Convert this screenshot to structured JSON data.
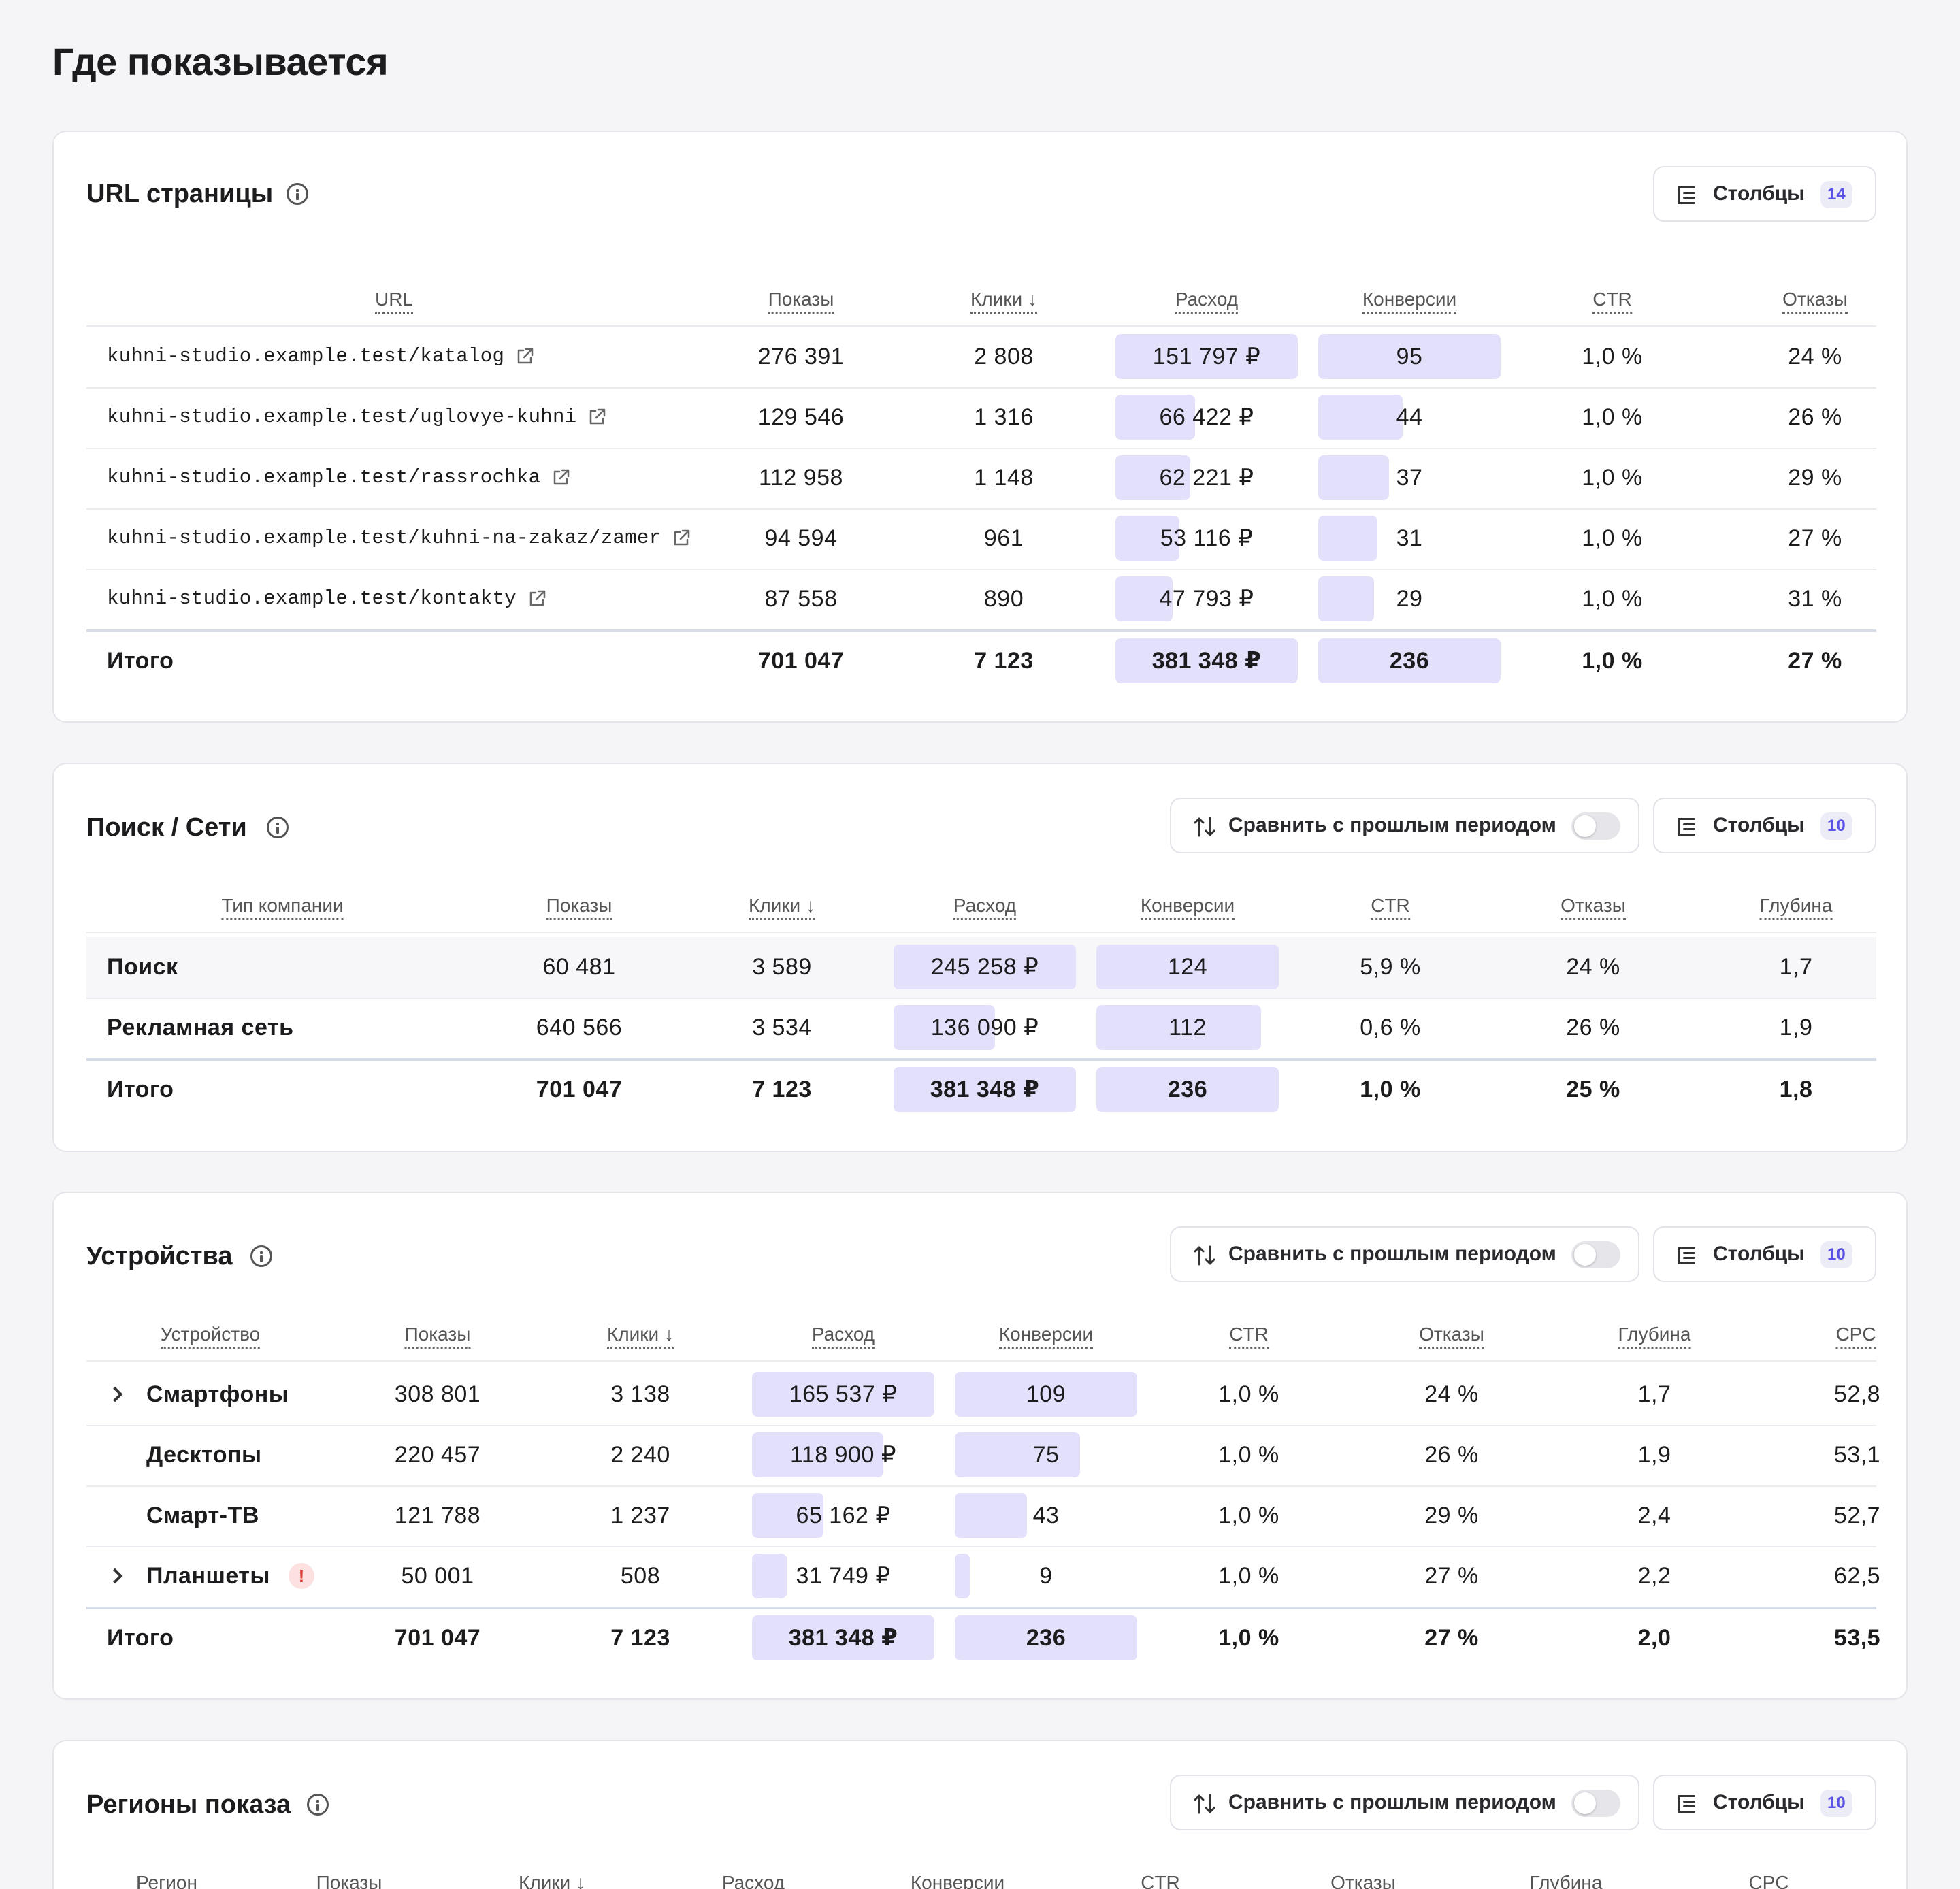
{
  "page_title": "Где показывается",
  "compare_label": "Сравнить с прошлым периодом",
  "columns_label": "Столбцы",
  "total_label": "Итого",
  "colors": {
    "bar": "#e3e0fb",
    "badge_text": "#5b52e6",
    "warn": "#e0403a"
  },
  "url_section": {
    "title": "URL страницы",
    "columns_count": "14",
    "headers": [
      "URL",
      "Показы",
      "Клики ↓",
      "Расход",
      "Конверсии",
      "CTR",
      "Отказы"
    ],
    "rows": [
      {
        "url": "kuhni-studio.example.test/katalog",
        "shows": "276 391",
        "clicks": "2 808",
        "spend": "151 797 ₽",
        "conv": "95",
        "ctr": "1,0 %",
        "bounce": "24 %",
        "spend_frac": 1.0,
        "conv_frac": 1.0
      },
      {
        "url": "kuhni-studio.example.test/uglovye-kuhni",
        "shows": "129 546",
        "clicks": "1 316",
        "spend": "66 422 ₽",
        "conv": "44",
        "ctr": "1,0 %",
        "bounce": "26 %",
        "spend_frac": 0.4376,
        "conv_frac": 0.4632
      },
      {
        "url": "kuhni-studio.example.test/rassrochka",
        "shows": "112 958",
        "clicks": "1 148",
        "spend": "62 221 ₽",
        "conv": "37",
        "ctr": "1,0 %",
        "bounce": "29 %",
        "spend_frac": 0.4099,
        "conv_frac": 0.3895
      },
      {
        "url": "kuhni-studio.example.test/kuhni-na-zakaz/zamer",
        "shows": "94 594",
        "clicks": "961",
        "spend": "53 116 ₽",
        "conv": "31",
        "ctr": "1,0 %",
        "bounce": "27 %",
        "spend_frac": 0.3499,
        "conv_frac": 0.3263
      },
      {
        "url": "kuhni-studio.example.test/kontakty",
        "shows": "87 558",
        "clicks": "890",
        "spend": "47 793 ₽",
        "conv": "29",
        "ctr": "1,0 %",
        "bounce": "31 %",
        "spend_frac": 0.3149,
        "conv_frac": 0.3053
      }
    ],
    "total": {
      "shows": "701 047",
      "clicks": "7 123",
      "spend": "381 348 ₽",
      "conv": "236",
      "ctr": "1,0 %",
      "bounce": "27 %"
    }
  },
  "search_section": {
    "title": "Поиск / Сети",
    "columns_count": "10",
    "headers": [
      "Тип компании",
      "Показы",
      "Клики ↓",
      "Расход",
      "Конверсии",
      "CTR",
      "Отказы",
      "Глубина"
    ],
    "rows": [
      {
        "name": "Поиск",
        "shows": "60 481",
        "clicks": "3 589",
        "spend": "245 258 ₽",
        "conv": "124",
        "ctr": "5,9 %",
        "bounce": "24 %",
        "depth": "1,7",
        "spend_frac": 1.0,
        "conv_frac": 1.0
      },
      {
        "name": "Рекламная сеть",
        "shows": "640 566",
        "clicks": "3 534",
        "spend": "136 090 ₽",
        "conv": "112",
        "ctr": "0,6 %",
        "bounce": "26 %",
        "depth": "1,9",
        "spend_frac": 0.5549,
        "conv_frac": 0.9032
      }
    ],
    "total": {
      "shows": "701 047",
      "clicks": "7 123",
      "spend": "381 348 ₽",
      "conv": "236",
      "ctr": "1,0 %",
      "bounce": "25 %",
      "depth": "1,8"
    }
  },
  "devices_section": {
    "title": "Устройства",
    "columns_count": "10",
    "headers": [
      "Устройство",
      "Показы",
      "Клики ↓",
      "Расход",
      "Конверсии",
      "CTR",
      "Отказы",
      "Глубина",
      "CPC"
    ],
    "rows": [
      {
        "name": "Смартфоны",
        "expandable": true,
        "warning": false,
        "shows": "308 801",
        "clicks": "3 138",
        "spend": "165 537 ₽",
        "conv": "109",
        "ctr": "1,0 %",
        "bounce": "24 %",
        "depth": "1,7",
        "cpc": "52,8",
        "spend_frac": 1.0,
        "conv_frac": 1.0
      },
      {
        "name": "Десктопы",
        "expandable": false,
        "warning": false,
        "shows": "220 457",
        "clicks": "2 240",
        "spend": "118 900 ₽",
        "conv": "75",
        "ctr": "1,0 %",
        "bounce": "26 %",
        "depth": "1,9",
        "cpc": "53,1",
        "spend_frac": 0.7183,
        "conv_frac": 0.6881
      },
      {
        "name": "Смарт-ТВ",
        "expandable": false,
        "warning": false,
        "shows": "121 788",
        "clicks": "1 237",
        "spend": "65 162 ₽",
        "conv": "43",
        "ctr": "1,0 %",
        "bounce": "29 %",
        "depth": "2,4",
        "cpc": "52,7",
        "spend_frac": 0.3936,
        "conv_frac": 0.3945
      },
      {
        "name": "Планшеты",
        "expandable": true,
        "warning": true,
        "warning_label": "!",
        "shows": "50 001",
        "clicks": "508",
        "spend": "31 749 ₽",
        "conv": "9",
        "ctr": "1,0 %",
        "bounce": "27 %",
        "depth": "2,2",
        "cpc": "62,5",
        "spend_frac": 0.1918,
        "conv_frac": 0.0826
      }
    ],
    "total": {
      "shows": "701 047",
      "clicks": "7 123",
      "spend": "381 348 ₽",
      "conv": "236",
      "ctr": "1,0 %",
      "bounce": "27 %",
      "depth": "2,0",
      "cpc": "53,5"
    }
  },
  "regions_section": {
    "title": "Регионы показа",
    "columns_count": "10",
    "headers": [
      "Регион",
      "Показы",
      "Клики ↓",
      "Расход",
      "Конверсии",
      "CTR",
      "Отказы",
      "Глубина",
      "CPC"
    ]
  }
}
